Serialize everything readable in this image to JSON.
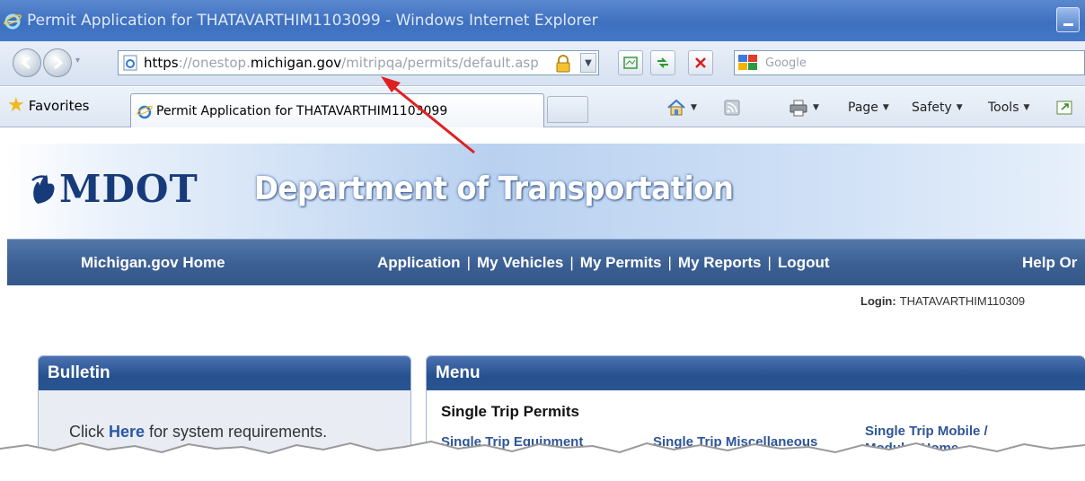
{
  "window": {
    "title": "Permit Application for THATAVARTHIM1103099 - Windows Internet Explorer"
  },
  "address_bar": {
    "url_scheme": "https",
    "url_sep": "://onestop.",
    "url_host": "michigan.gov",
    "url_path": "/mitripqa/permits/default.asp",
    "search_placeholder": "Google"
  },
  "favorites_bar": {
    "favorites_label": "Favorites",
    "active_tab_title": "Permit Application for THATAVARTHIM1103099",
    "commands": {
      "page": "Page",
      "safety": "Safety",
      "tools": "Tools"
    }
  },
  "site": {
    "logo_text": "MDOT",
    "banner_title": "Department of Transportation",
    "nav": {
      "home": "Michigan.gov Home",
      "links": [
        "Application",
        "My Vehicles",
        "My Permits",
        "My Reports",
        "Logout"
      ],
      "separator": "|",
      "help": "Help Or"
    },
    "login": {
      "label": "Login:",
      "user": "THATAVARTHIM110309"
    }
  },
  "bulletin": {
    "title": "Bulletin",
    "text_before": "Click ",
    "link": "Here",
    "text_after": " for system requirements."
  },
  "menu": {
    "title": "Menu",
    "section": "Single Trip Permits",
    "items": [
      "Single Trip Equipment",
      "Single Trip Miscellaneous",
      "Single Trip Mobile / Modular Home"
    ]
  },
  "colors": {
    "nav_strip": "#3b5f93",
    "panel_header": "#26508e",
    "link": "#2f5597",
    "arrow": "#e02020"
  }
}
